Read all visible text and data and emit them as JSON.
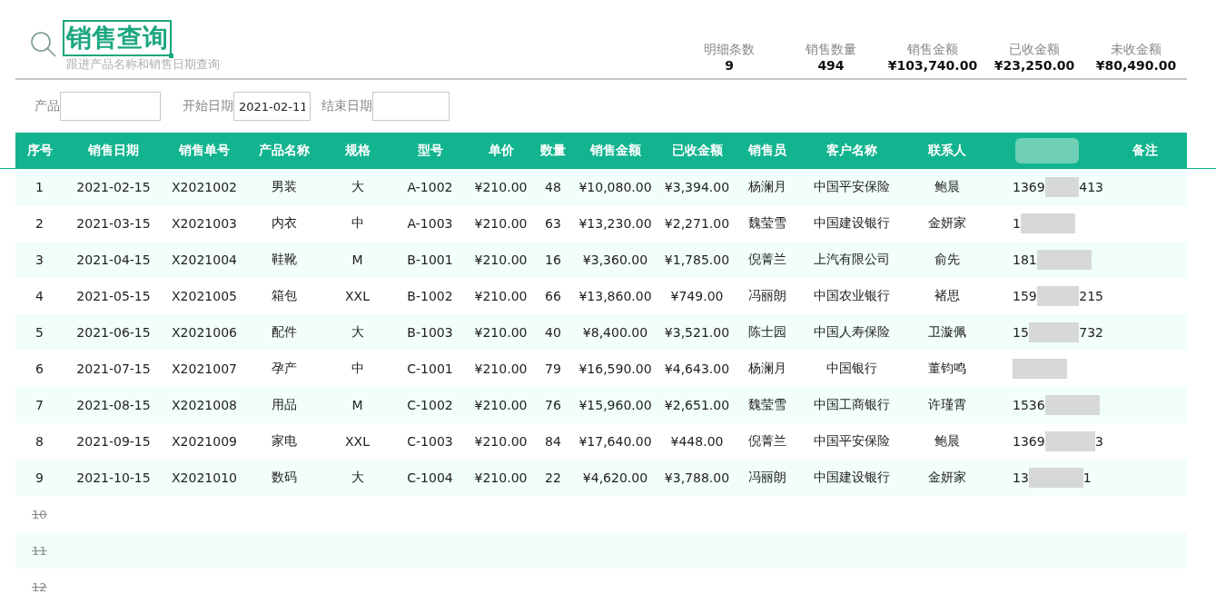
{
  "header": {
    "title": "销售查询",
    "subtitle": "跟进产品名称和销售日期查询"
  },
  "summary": [
    {
      "label": "明细条数",
      "value": "9"
    },
    {
      "label": "销售数量",
      "value": "494"
    },
    {
      "label": "销售金额",
      "value": "¥103,740.00"
    },
    {
      "label": "已收金额",
      "value": "¥23,250.00"
    },
    {
      "label": "未收金额",
      "value": "¥80,490.00"
    }
  ],
  "filters": [
    {
      "label": "产品"
    },
    {
      "label": "开始日期",
      "value": "2021-02-11"
    },
    {
      "label": "结束日期"
    }
  ],
  "table": {
    "columns": [
      {
        "label": "序号"
      },
      {
        "label": "销售日期"
      },
      {
        "label": "销售单号"
      },
      {
        "label": "产品名称"
      },
      {
        "label": "规格"
      },
      {
        "label": "型号"
      },
      {
        "label": "单价"
      },
      {
        "label": "数量"
      },
      {
        "label": "销售金额"
      },
      {
        "label": "已收金额"
      },
      {
        "label": "销售员"
      },
      {
        "label": "客户名称"
      },
      {
        "label": "联系人"
      },
      {
        "blurred": true
      },
      {
        "label": "备注"
      }
    ],
    "rows": [
      {
        "cells": [
          "1",
          "2021-02-15",
          "X2021002",
          "男装",
          "大",
          "A-1002",
          "¥210.00",
          "48",
          "¥10,080.00",
          "¥3,394.00",
          "杨澜月",
          "中国平安保险",
          "鲍晨"
        ],
        "column_14": {
          "start": "1369",
          "end": "413"
        }
      },
      {
        "cells": [
          "2",
          "2021-03-15",
          "X2021003",
          "内衣",
          "中",
          "A-1003",
          "¥210.00",
          "63",
          "¥13,230.00",
          "¥2,271.00",
          "魏莹雪",
          "中国建设银行",
          "金妍家"
        ],
        "column_14": {
          "start": "1"
        }
      },
      {
        "cells": [
          "3",
          "2021-04-15",
          "X2021004",
          "鞋靴",
          "M",
          "B-1001",
          "¥210.00",
          "16",
          "¥3,360.00",
          "¥1,785.00",
          "倪菁兰",
          "上汽有限公司",
          "俞先"
        ],
        "column_14": {
          "start": "181"
        }
      },
      {
        "cells": [
          "4",
          "2021-05-15",
          "X2021005",
          "箱包",
          "XXL",
          "B-1002",
          "¥210.00",
          "66",
          "¥13,860.00",
          "¥749.00",
          "冯丽朗",
          "中国农业银行",
          "褚思"
        ],
        "column_14": {
          "start": "159",
          "end": "215"
        }
      },
      {
        "cells": [
          "5",
          "2021-06-15",
          "X2021006",
          "配件",
          "大",
          "B-1003",
          "¥210.00",
          "40",
          "¥8,400.00",
          "¥3,521.00",
          "陈士园",
          "中国人寿保险",
          "卫漩佩"
        ],
        "column_14": {
          "start": "15",
          "end": "732"
        }
      },
      {
        "cells": [
          "6",
          "2021-07-15",
          "X2021007",
          "孕产",
          "中",
          "C-1001",
          "¥210.00",
          "79",
          "¥16,590.00",
          "¥4,643.00",
          "杨澜月",
          "中国银行",
          "董钧鸣"
        ],
        "column_14": {}
      },
      {
        "cells": [
          "7",
          "2021-08-15",
          "X2021008",
          "用品",
          "M",
          "C-1002",
          "¥210.00",
          "76",
          "¥15,960.00",
          "¥2,651.00",
          "魏莹雪",
          "中国工商银行",
          "许瑾霄"
        ],
        "column_14": {
          "start": "1536"
        }
      },
      {
        "cells": [
          "8",
          "2021-09-15",
          "X2021009",
          "家电",
          "XXL",
          "C-1003",
          "¥210.00",
          "84",
          "¥17,640.00",
          "¥448.00",
          "倪菁兰",
          "中国平安保险",
          "鲍晨"
        ],
        "column_14": {
          "start": "1369",
          "end": "3"
        }
      },
      {
        "cells": [
          "9",
          "2021-10-15",
          "X2021010",
          "数码",
          "大",
          "C-1004",
          "¥210.00",
          "22",
          "¥4,620.00",
          "¥3,788.00",
          "冯丽朗",
          "中国建设银行",
          "金妍家"
        ],
        "column_14": {
          "start": "13",
          "end": "1"
        }
      }
    ],
    "empty_rows": [
      {
        "index": "10",
        "struck": true
      },
      {
        "index": "11",
        "struck": true
      },
      {
        "index": "12",
        "struck": true
      }
    ]
  }
}
